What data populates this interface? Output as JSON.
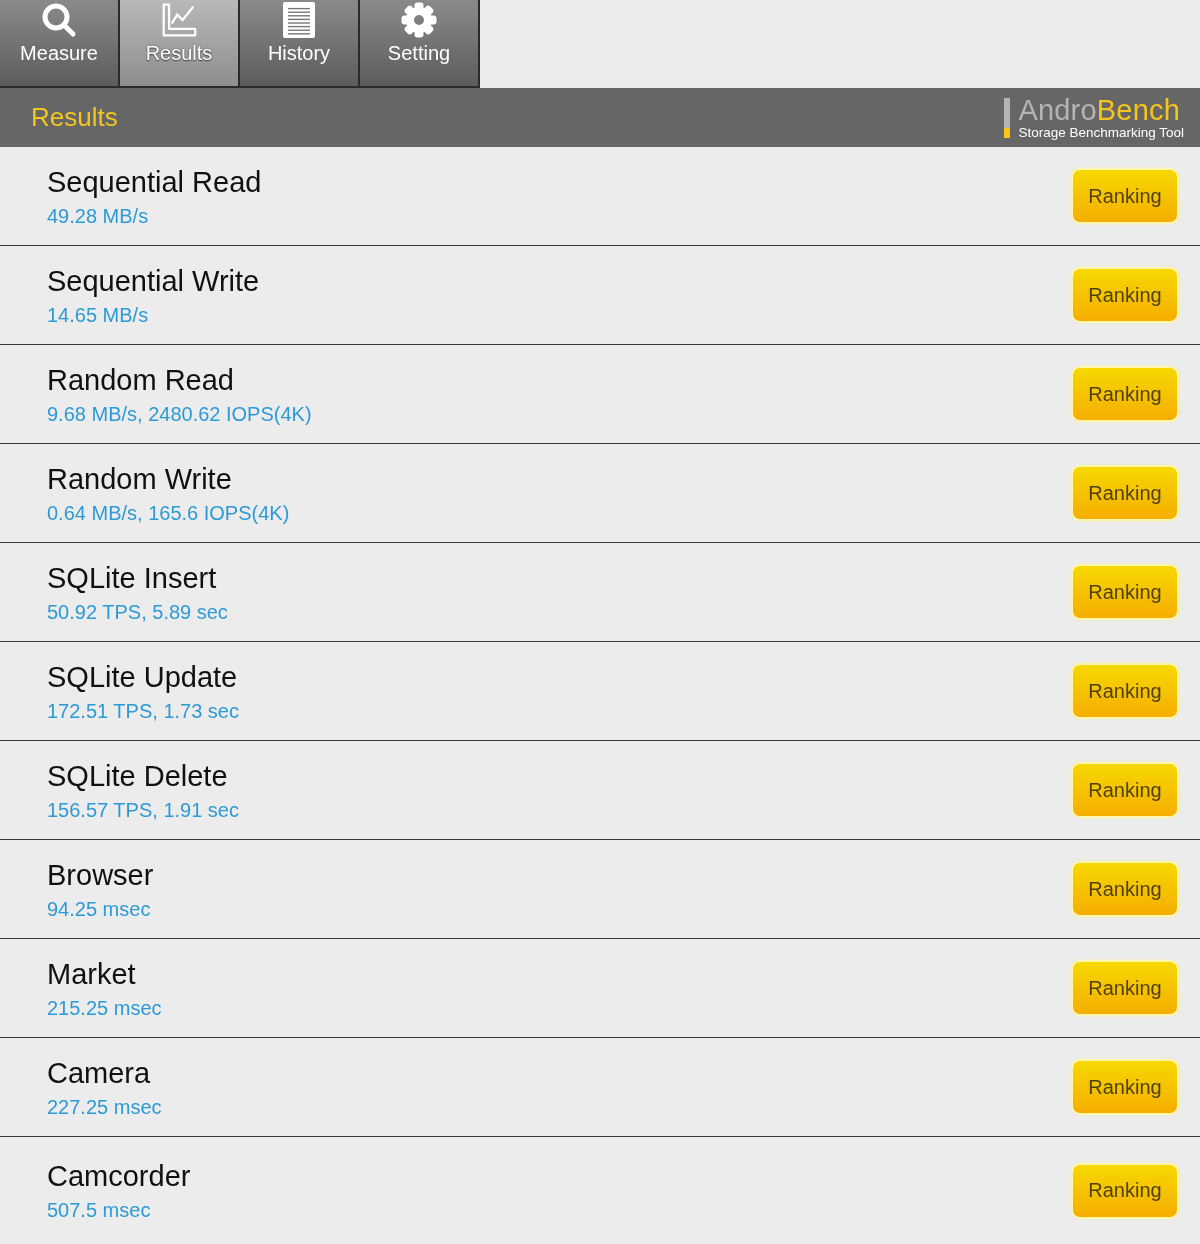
{
  "tabs": [
    {
      "label": "Measure",
      "selected": false
    },
    {
      "label": "Results",
      "selected": true
    },
    {
      "label": "History",
      "selected": false
    },
    {
      "label": "Setting",
      "selected": false
    }
  ],
  "header": {
    "title": "Results",
    "logo": {
      "name_start": "Andro",
      "name_end": "Bench",
      "tagline": "Storage Benchmarking Tool"
    }
  },
  "results": [
    {
      "name": "Sequential Read",
      "value": "49.28 MB/s",
      "button": "Ranking"
    },
    {
      "name": "Sequential Write",
      "value": "14.65 MB/s",
      "button": "Ranking"
    },
    {
      "name": "Random Read",
      "value": "9.68 MB/s, 2480.62 IOPS(4K)",
      "button": "Ranking"
    },
    {
      "name": "Random Write",
      "value": "0.64 MB/s, 165.6 IOPS(4K)",
      "button": "Ranking"
    },
    {
      "name": "SQLite Insert",
      "value": "50.92 TPS, 5.89 sec",
      "button": "Ranking"
    },
    {
      "name": "SQLite Update",
      "value": "172.51 TPS, 1.73 sec",
      "button": "Ranking"
    },
    {
      "name": "SQLite Delete",
      "value": "156.57 TPS, 1.91 sec",
      "button": "Ranking"
    },
    {
      "name": "Browser",
      "value": "94.25 msec",
      "button": "Ranking"
    },
    {
      "name": "Market",
      "value": "215.25 msec",
      "button": "Ranking"
    },
    {
      "name": "Camera",
      "value": "227.25 msec",
      "button": "Ranking"
    },
    {
      "name": "Camcorder",
      "value": "507.5 msec",
      "button": "Ranking"
    }
  ]
}
